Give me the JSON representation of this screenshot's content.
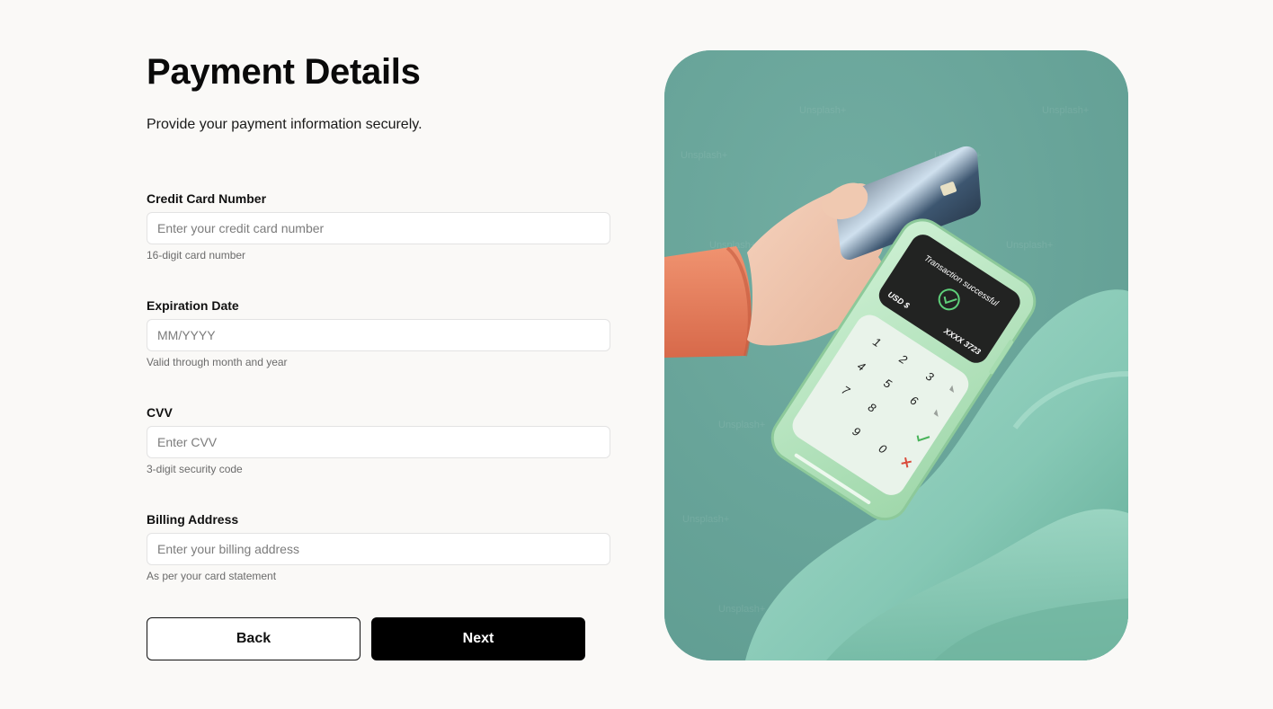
{
  "page": {
    "title": "Payment Details",
    "subtitle": "Provide your payment information securely."
  },
  "fields": [
    {
      "label": "Credit Card Number",
      "placeholder": "Enter your credit card number",
      "value": "",
      "hint": "16-digit card number"
    },
    {
      "label": "Expiration Date",
      "placeholder": "MM/YYYY",
      "value": "",
      "hint": "Valid through month and year"
    },
    {
      "label": "CVV",
      "placeholder": "Enter CVV",
      "value": "",
      "hint": "3-digit security code"
    },
    {
      "label": "Billing Address",
      "placeholder": "Enter your billing address",
      "value": "",
      "hint": "As per your card statement"
    }
  ],
  "buttons": {
    "back": "Back",
    "next": "Next"
  },
  "illustration": {
    "watermark": "Unsplash+",
    "terminal": {
      "status": "Transaction successful",
      "currency": "USD $",
      "card_masked": "XXXX 3723",
      "keys": [
        "1",
        "2",
        "3",
        "4",
        "5",
        "6",
        "7",
        "8",
        "9",
        "0"
      ]
    }
  },
  "colors": {
    "background": "#faf9f7",
    "primary_button": "#000000",
    "illustration_bg": "#6aa89d",
    "terminal_body": "#bfe8c6",
    "sleeve": "#e8825f"
  }
}
